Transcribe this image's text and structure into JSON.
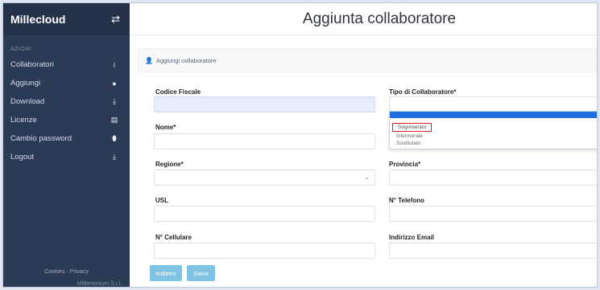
{
  "sidebar": {
    "brand": "Millecloud",
    "section_label": "AZIONI",
    "items": [
      {
        "label": "Collaboratori",
        "icon": "i"
      },
      {
        "label": "Aggiungi",
        "icon": "●"
      },
      {
        "label": "Download",
        "icon": "⤓"
      },
      {
        "label": "Licenze",
        "icon": "▤"
      },
      {
        "label": "Cambio password",
        "icon": "⬮"
      },
      {
        "label": "Logout",
        "icon": "⤓"
      }
    ],
    "footer_links": "Cookies · Privacy",
    "footer_company": "Millemonium S.r.l."
  },
  "header": {
    "title": "Aggiunta collaboratore"
  },
  "card": {
    "heading": "Aggiungi collaboratore"
  },
  "form": {
    "codice_fiscale": {
      "label": "Codice Fiscale",
      "value": ""
    },
    "tipo": {
      "label": "Tipo di Collaboratore*",
      "value": ""
    },
    "nome": {
      "label": "Nome*",
      "value": ""
    },
    "regione": {
      "label": "Regione*",
      "value": ""
    },
    "provincia": {
      "label": "Provincia*",
      "value": ""
    },
    "usl": {
      "label": "USL",
      "value": ""
    },
    "telefono": {
      "label": "N° Telefono",
      "value": ""
    },
    "cellulare": {
      "label": "N° Cellulare",
      "value": ""
    },
    "email": {
      "label": "Indirizzo Email",
      "value": ""
    }
  },
  "dropdown_options": [
    "Segretariato",
    "Infermerale",
    "Sostitutalo"
  ],
  "buttons": {
    "back": "Indietro",
    "save": "Salva"
  },
  "colors": {
    "sidebar": "#2b3a55",
    "accent": "#1f6fe0",
    "button": "#7ec3e3",
    "highlight": "#d0242b"
  }
}
